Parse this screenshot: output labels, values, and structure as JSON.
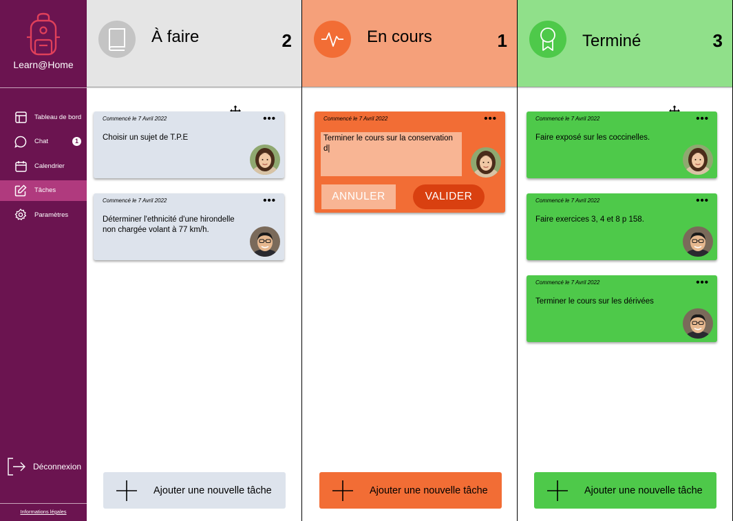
{
  "app": {
    "name": "Learn@Home",
    "legal": "Informations légales",
    "logout": "Déconnexion"
  },
  "nav": [
    {
      "label": "Tableau de bord",
      "icon": "dashboard-icon",
      "active": false
    },
    {
      "label": "Chat",
      "icon": "chat-icon",
      "active": false,
      "badge": "1"
    },
    {
      "label": "Calendrier",
      "icon": "calendar-icon",
      "active": false
    },
    {
      "label": "Tâches",
      "icon": "edit-icon",
      "active": true
    },
    {
      "label": "Paramètres",
      "icon": "gear-icon",
      "active": false
    }
  ],
  "columns": [
    {
      "title": "À faire",
      "count": "2",
      "icon": "book-icon",
      "add_label": "Ajouter une nouvelle tâche",
      "cards": [
        {
          "date": "Commencé le 7 Avril 2022",
          "text": "Choisir un sujet de T.P.E",
          "avatar": "woman-avatar"
        },
        {
          "date": "Commencé le 7 Avril 2022",
          "text": "Déterminer l'ethnicité d'une hirondelle non chargée volant à 77 km/h.",
          "avatar": "man-avatar"
        }
      ]
    },
    {
      "title": "En cours",
      "count": "1",
      "icon": "pulse-icon",
      "add_label": "Ajouter une nouvelle tâche",
      "cards": [
        {
          "date": "Commencé le 7 Avril 2022",
          "text": "Terminer le cours sur la conservation d|",
          "avatar": "woman-avatar",
          "cancel": "ANNULER",
          "validate": "VALIDER"
        }
      ]
    },
    {
      "title": "Terminé",
      "count": "3",
      "icon": "award-icon",
      "add_label": "Ajouter une nouvelle tâche",
      "cards": [
        {
          "date": "Commencé le 7 Avril 2022",
          "text": "Faire exposé sur les coccinelles.",
          "avatar": "woman-avatar"
        },
        {
          "date": "Commencé le 7 Avril 2022",
          "text": "Faire exercices 3, 4 et 8 p 158.",
          "avatar": "man-avatar"
        },
        {
          "date": "Commencé le 7 Avril 2022",
          "text": "Terminer le cours sur les dérivées",
          "avatar": "man-avatar"
        }
      ]
    }
  ],
  "more_glyph": "•••",
  "colors": {
    "sidebar": "#6b1450",
    "active": "#b03a7e",
    "todo": "#e5e5e5",
    "doing": "#f26d35",
    "done": "#4ec94a"
  }
}
